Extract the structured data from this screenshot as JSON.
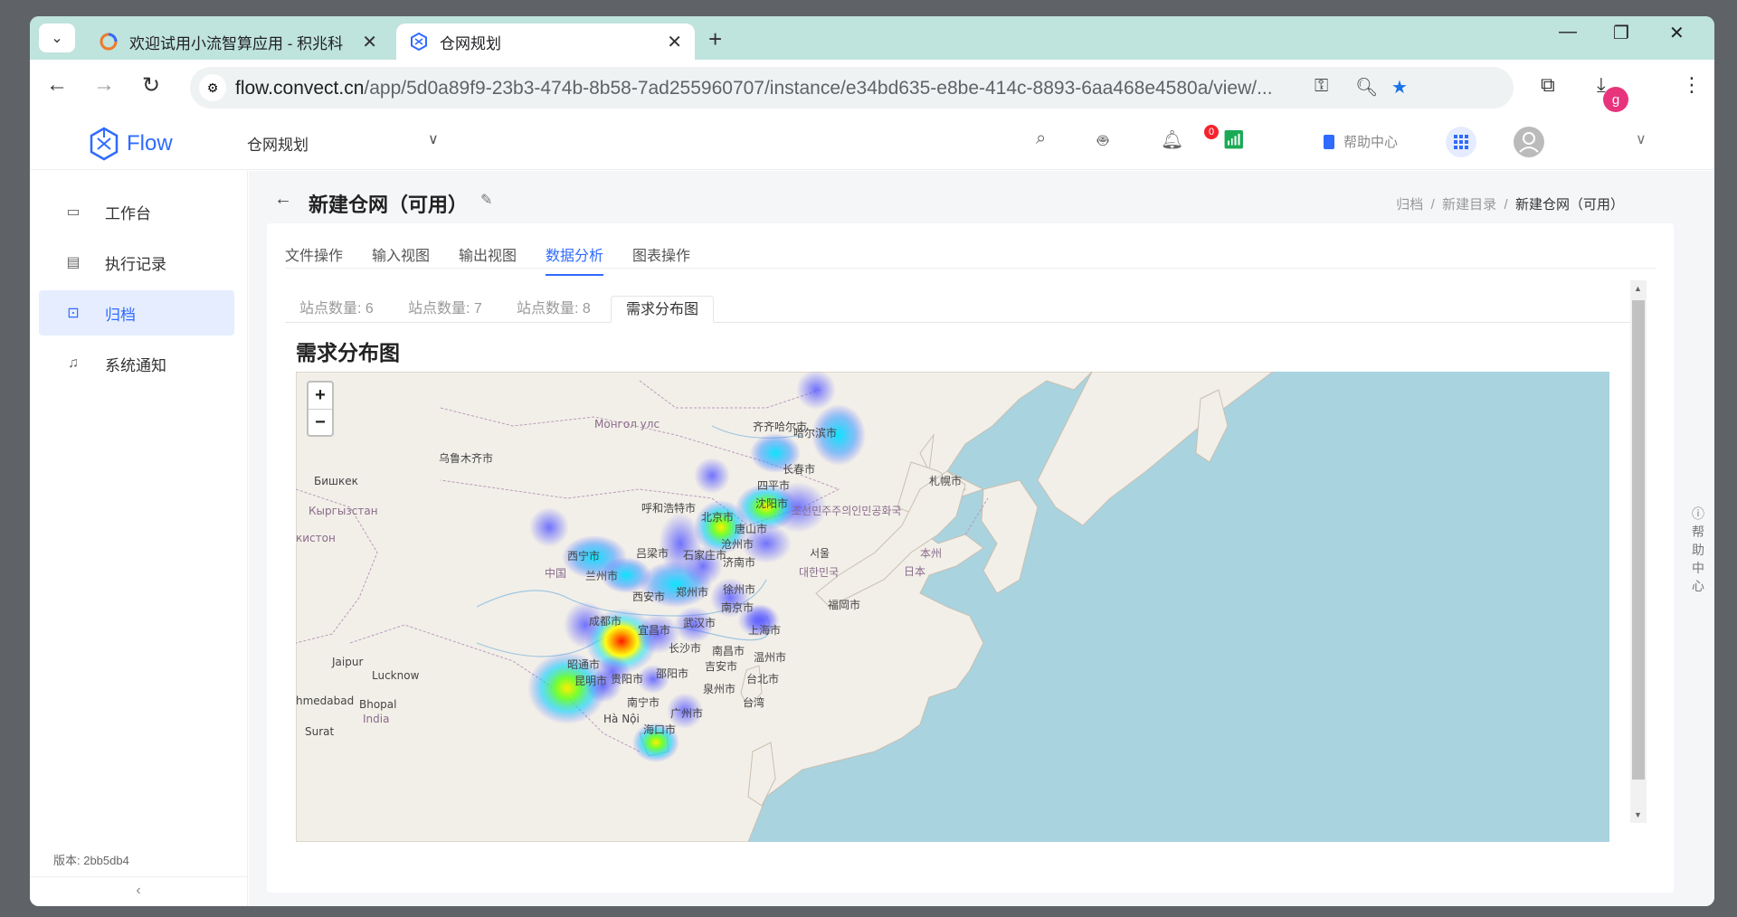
{
  "browser": {
    "tabs": [
      {
        "title": "欢迎试用小流智算应用 - 积兆科",
        "active": false
      },
      {
        "title": "仓网规划",
        "active": true
      }
    ],
    "url_host": "flow.convect.cn",
    "url_path": "/app/5d0a89f9-23b3-474b-8b58-7ad255960707/instance/e34bd635-e8be-414c-8893-6aa468e4580a/view/...",
    "profile_initial": "g"
  },
  "app": {
    "logo_text": "Flow",
    "project": "仓网规划",
    "notification_count": "0",
    "help_label": "帮助中心"
  },
  "sidebar": {
    "items": [
      {
        "label": "工作台",
        "icon": "dashboard-icon",
        "active": false
      },
      {
        "label": "执行记录",
        "icon": "clipboard-icon",
        "active": false
      },
      {
        "label": "归档",
        "icon": "archive-box-icon",
        "active": true
      },
      {
        "label": "系统通知",
        "icon": "bell-icon",
        "active": false
      }
    ],
    "version": "版本: 2bb5db4",
    "collapse_glyph": "‹"
  },
  "page": {
    "title": "新建仓网（可用）",
    "breadcrumb": [
      "归档",
      "新建目录",
      "新建仓网（可用）"
    ],
    "tabs": [
      "文件操作",
      "输入视图",
      "输出视图",
      "数据分析",
      "图表操作"
    ],
    "active_tab": "数据分析",
    "subtabs": [
      "站点数量: 6",
      "站点数量: 7",
      "站点数量: 8",
      "需求分布图"
    ],
    "active_subtab": "需求分布图",
    "chart_title": "需求分布图"
  },
  "map": {
    "zoom_in": "+",
    "zoom_out": "−",
    "cities": [
      {
        "name": "乌鲁木齐市"
      },
      {
        "name": "Бишкек"
      },
      {
        "name": "Кыргызстан"
      },
      {
        "name": "Монгол улс"
      },
      {
        "name": "呼和浩特市"
      },
      {
        "name": "齐齐哈尔市"
      },
      {
        "name": "哈尔滨市"
      },
      {
        "name": "长春市"
      },
      {
        "name": "四平市"
      },
      {
        "name": "沈阳市"
      },
      {
        "name": "北京市"
      },
      {
        "name": "唐山市"
      },
      {
        "name": "沧州市"
      },
      {
        "name": "济南市"
      },
      {
        "name": "石家庄市"
      },
      {
        "name": "吕梁市"
      },
      {
        "name": "西宁市"
      },
      {
        "name": "兰州市"
      },
      {
        "name": "中国"
      },
      {
        "name": "郑州市"
      },
      {
        "name": "徐州市"
      },
      {
        "name": "西安市"
      },
      {
        "name": "南京市"
      },
      {
        "name": "成都市"
      },
      {
        "name": "武汉市"
      },
      {
        "name": "上海市"
      },
      {
        "name": "宜昌市"
      },
      {
        "name": "长沙市"
      },
      {
        "name": "南昌市"
      },
      {
        "name": "温州市"
      },
      {
        "name": "昭通市"
      },
      {
        "name": "昆明市"
      },
      {
        "name": "贵阳市"
      },
      {
        "name": "邵阳市"
      },
      {
        "name": "吉安市"
      },
      {
        "name": "泉州市"
      },
      {
        "name": "台北市"
      },
      {
        "name": "台湾"
      },
      {
        "name": "南宁市"
      },
      {
        "name": "广州市"
      },
      {
        "name": "海口市"
      },
      {
        "name": "Hà Nội"
      },
      {
        "name": "조선민주주의인민공화국"
      },
      {
        "name": "서울"
      },
      {
        "name": "대한민국"
      },
      {
        "name": "札幌市"
      },
      {
        "name": "本州"
      },
      {
        "name": "日本"
      },
      {
        "name": "福岡市"
      },
      {
        "name": "Jaipur"
      },
      {
        "name": "Lucknow"
      },
      {
        "name": "Bhopal"
      },
      {
        "name": "India"
      },
      {
        "name": "Surat"
      },
      {
        "name": "hmedabad"
      },
      {
        "name": "кистон"
      },
      {
        "name": "Кыргызстан"
      }
    ]
  },
  "right_help": [
    "帮",
    "助",
    "中",
    "心"
  ]
}
